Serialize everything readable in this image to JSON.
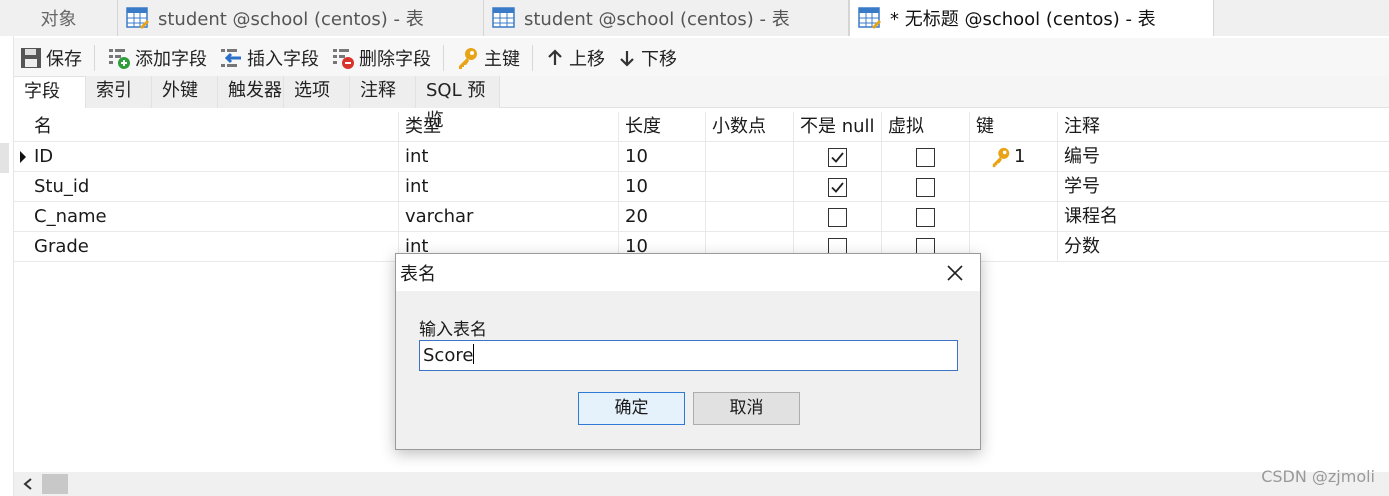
{
  "tabs": [
    {
      "label": "对象"
    },
    {
      "label": "student @school (centos) - 表"
    },
    {
      "label": "student @school (centos) - 表"
    },
    {
      "label": "* 无标题 @school (centos) - 表"
    }
  ],
  "toolbar": {
    "save": "保存",
    "add_field": "添加字段",
    "insert_field": "插入字段",
    "delete_field": "删除字段",
    "primary_key": "主键",
    "move_up": "上移",
    "move_down": "下移"
  },
  "subtabs": [
    "字段",
    "索引",
    "外键",
    "触发器",
    "选项",
    "注释",
    "SQL 预览"
  ],
  "grid": {
    "headers": [
      "名",
      "类型",
      "长度",
      "小数点",
      "不是 null",
      "虚拟",
      "键",
      "注释"
    ],
    "rows": [
      {
        "name": "ID",
        "type": "int",
        "length": "10",
        "decimals": "",
        "not_null": true,
        "virtual": false,
        "key": "1",
        "comment": "编号"
      },
      {
        "name": "Stu_id",
        "type": "int",
        "length": "10",
        "decimals": "",
        "not_null": true,
        "virtual": false,
        "key": "",
        "comment": "学号"
      },
      {
        "name": "C_name",
        "type": "varchar",
        "length": "20",
        "decimals": "",
        "not_null": false,
        "virtual": false,
        "key": "",
        "comment": "课程名"
      },
      {
        "name": "Grade",
        "type": "int",
        "length": "10",
        "decimals": "",
        "not_null": false,
        "virtual": false,
        "key": "",
        "comment": "分数"
      }
    ]
  },
  "dialog": {
    "title": "表名",
    "label": "输入表名",
    "value": "Score",
    "ok": "确定",
    "cancel": "取消"
  },
  "watermark": "CSDN @zjmoli",
  "colors": {
    "accent": "#2f7ad6",
    "key": "#e8a317",
    "add": "#2e9e3a",
    "delete": "#d9342b"
  }
}
